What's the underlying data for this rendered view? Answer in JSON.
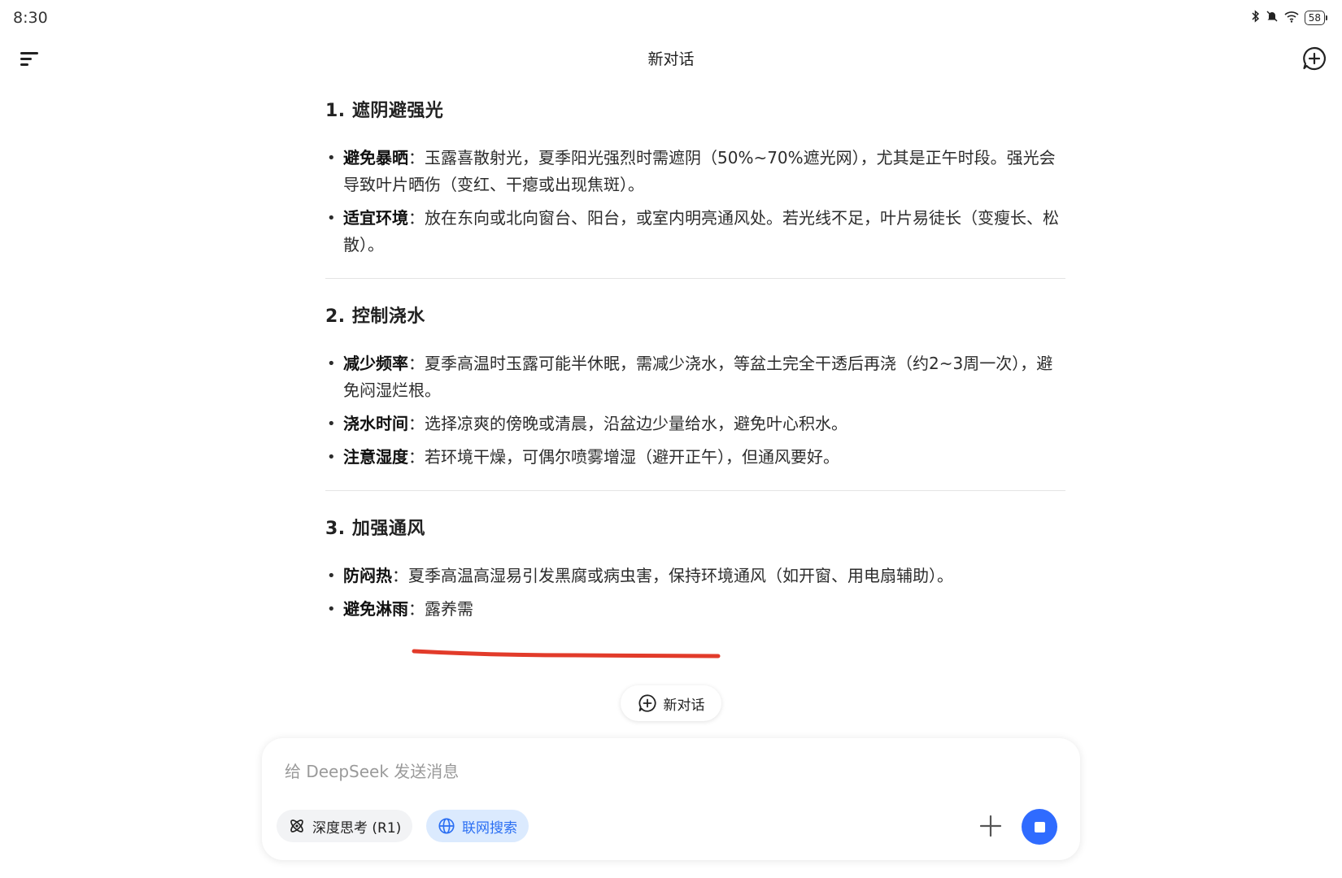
{
  "status_bar": {
    "time": "8:30",
    "battery": "58",
    "icons": [
      "bluetooth-icon",
      "mute-icon",
      "wifi-icon",
      "battery-icon"
    ]
  },
  "header": {
    "title": "新对话",
    "menu_icon": "menu-icon",
    "new_chat_icon": "new-chat-icon"
  },
  "content": {
    "sections": [
      {
        "title": "1. 遮阴避强光",
        "items": [
          {
            "term": "避免暴晒",
            "sep": "：",
            "text": "玉露喜散射光，夏季阳光强烈时需遮阴（50%~70%遮光网），尤其是正午时段。强光会导致叶片晒伤（变红、干瘪或出现焦斑）。"
          },
          {
            "term": "适宜环境",
            "sep": "：",
            "text": "放在东向或北向窗台、阳台，或室内明亮通风处。若光线不足，叶片易徒长（变瘦长、松散）。"
          }
        ]
      },
      {
        "title": "2. 控制浇水",
        "items": [
          {
            "term": "减少频率",
            "sep": "：",
            "text": "夏季高温时玉露可能半休眠，需减少浇水，等盆土完全干透后再浇（约2~3周一次），避免闷湿烂根。"
          },
          {
            "term": "浇水时间",
            "sep": "：",
            "text": "选择凉爽的傍晚或清晨，沿盆边少量给水，避免叶心积水。"
          },
          {
            "term": "注意湿度",
            "sep": "：",
            "text": "若环境干燥，可偶尔喷雾增湿（避开正午），但通风要好。"
          }
        ]
      },
      {
        "title": "3. 加强通风",
        "items": [
          {
            "term": "防闷热",
            "sep": "：",
            "text": "夏季高温高湿易引发黑腐或病虫害，保持环境通风（如开窗、用电扇辅助）。"
          },
          {
            "term": "避免淋雨",
            "sep": "：",
            "text": "露养需"
          }
        ]
      }
    ]
  },
  "new_chat_pill": {
    "label": "新对话"
  },
  "composer": {
    "placeholder": "给 DeepSeek 发送消息",
    "value": "",
    "deep_think_label": "深度思考 (R1)",
    "web_search_label": "联网搜索",
    "colors": {
      "web_search_bg": "#dbeafe",
      "web_search_fg": "#2b6ff3",
      "send_bg": "#2f6bff"
    }
  },
  "annotation": {
    "color": "#e23b2a"
  }
}
